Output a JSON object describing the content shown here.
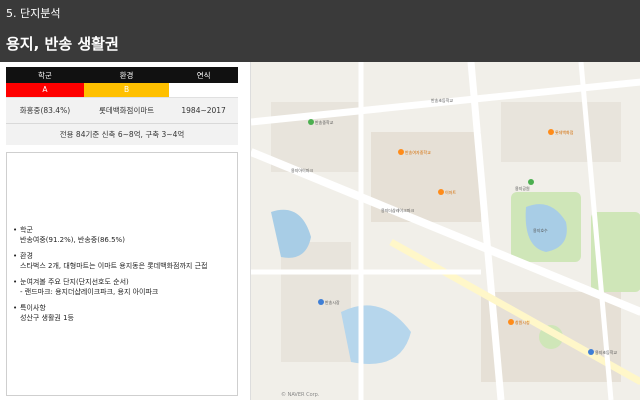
{
  "header": {
    "section": "5. 단지분석",
    "title": "용지, 반송 생활권"
  },
  "summary": {
    "columns": [
      "학군",
      "환경",
      "연식"
    ],
    "grades": [
      "A",
      "B",
      ""
    ],
    "values": [
      "화홍중(83.4%)",
      "롯데백화점이마트",
      "1984~2017"
    ],
    "note": "전용 84기준 신축 6~8억, 구축 3~4억"
  },
  "notes": {
    "school_title": "학군",
    "school_detail": "반송여중(91.2%), 반송중(86.5%)",
    "env_title": "환경",
    "env_detail": "스타벅스 2개, 대형마트는 이마트 용지동은 롯데백화점까지 근접",
    "landmark_title": "눈여겨볼 주요 단지(단지선호도 순서)",
    "landmark_detail": "- 랜드마크: 용지더샵레이크파크, 용지 아이파크",
    "special_title": "특이사항",
    "special_detail": "성산구 생활권 1등"
  },
  "map": {
    "labels": [
      "반송중학교",
      "반송여자중학교",
      "용지공원",
      "용지호수",
      "이마트",
      "롯데백화점",
      "용지더샵레이크파크",
      "용지아이파크",
      "창원시청",
      "반송시장",
      "용지초등학교",
      "반송초등학교"
    ],
    "copyright": "© NAVER Corp."
  },
  "colors": {
    "header_bg": "#3a3a3a",
    "grade_a": "#ff0000",
    "grade_b": "#ffc000",
    "table_head": "#111111",
    "map_road": "#ffffff",
    "map_park": "#cfe6b8",
    "map_water": "#a8cde6"
  }
}
